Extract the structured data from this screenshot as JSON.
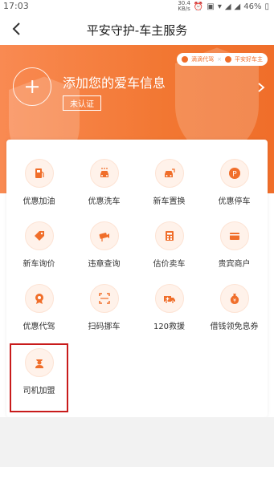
{
  "status_bar": {
    "time": "17:03",
    "net_speed": [
      "30.4",
      "KB/s"
    ],
    "battery": "46%"
  },
  "header": {
    "title": "平安守护-车主服务"
  },
  "banner": {
    "brands": [
      "滴滴代驾",
      "平安好车主"
    ],
    "add_car": "添加您的爱车信息",
    "badge": "未认证"
  },
  "services": [
    {
      "label": "优惠加油",
      "icon": "fuel-icon"
    },
    {
      "label": "优惠洗车",
      "icon": "car-wash-icon"
    },
    {
      "label": "新车置换",
      "icon": "car-exchange-icon"
    },
    {
      "label": "优惠停车",
      "icon": "parking-icon"
    },
    {
      "label": "新车询价",
      "icon": "price-tag-icon"
    },
    {
      "label": "违章查询",
      "icon": "camera-icon"
    },
    {
      "label": "估价卖车",
      "icon": "calculator-icon"
    },
    {
      "label": "贵宾商户",
      "icon": "card-icon"
    },
    {
      "label": "优惠代驾",
      "icon": "badge-icon"
    },
    {
      "label": "扫码挪车",
      "icon": "scan-icon"
    },
    {
      "label": "120救援",
      "icon": "ambulance-icon"
    },
    {
      "label": "借钱领免息券",
      "icon": "money-bag-icon"
    },
    {
      "label": "司机加盟",
      "icon": "driver-icon"
    }
  ],
  "colors": {
    "accent": "#f06e2a",
    "highlight": "#c81b1b"
  }
}
